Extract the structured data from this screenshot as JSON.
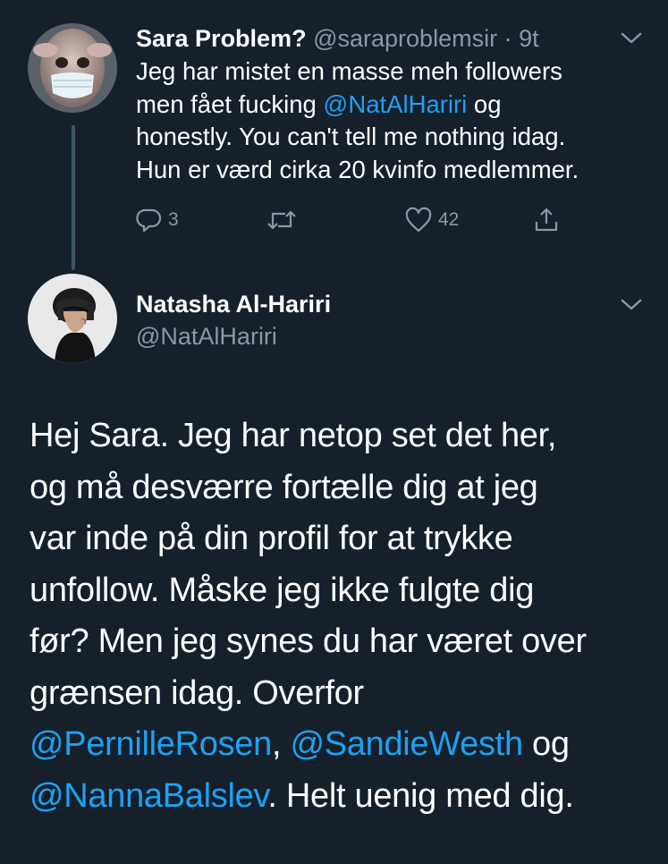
{
  "tweet1": {
    "name": "Sara Problem?",
    "handle": "@saraproblemsir",
    "separator": "·",
    "time": "9t",
    "text_parts": {
      "a": "Jeg har mistet en masse meh followers",
      "b": "men fået fucking ",
      "mention": "@NatAlHariri",
      "c": " og",
      "d": "honestly. You can't tell me nothing idag.",
      "e": "Hun er værd cirka 20 kvinfo medlemmer."
    },
    "actions": {
      "reply_icon": "reply-icon",
      "reply_count": "3",
      "retweet_icon": "retweet-icon",
      "like_icon": "heart-icon",
      "like_count": "42",
      "share_icon": "share-icon"
    }
  },
  "tweet2": {
    "name": "Natasha Al-Hariri",
    "handle": "@NatAlHariri",
    "lines": {
      "l1": "Hej Sara. Jeg har netop set det her,",
      "l2": "og må desværre fortælle dig at jeg",
      "l3": "var inde på din profil for at trykke",
      "l4": "unfollow. Måske jeg ikke fulgte dig",
      "l5": "før? Men jeg synes du har været over",
      "l6": "grænsen idag. Overfor",
      "m1": "@PernilleRosen",
      "sep1": ", ",
      "m2": "@SandieWesth",
      "og": " og",
      "m3": "@NannaBalslev",
      "tail": ". Helt uenig med dig."
    }
  },
  "colors": {
    "background": "#15202b",
    "text": "#ffffff",
    "muted": "#8899a6",
    "link": "#1da1f2",
    "thread_line": "#3d5466"
  }
}
